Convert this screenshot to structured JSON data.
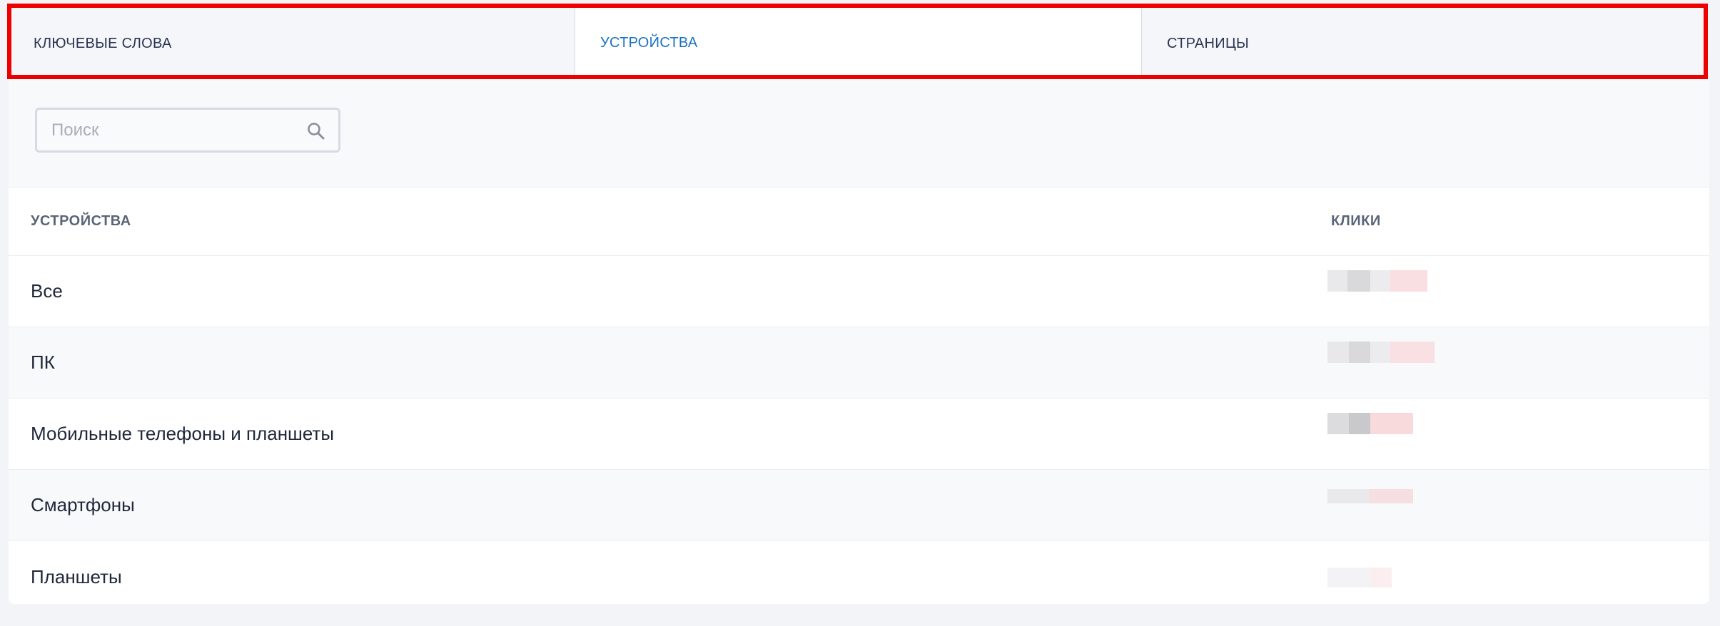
{
  "tabs": [
    {
      "label": "КЛЮЧЕВЫЕ СЛОВА",
      "active": false
    },
    {
      "label": "УСТРОЙСТВА",
      "active": true
    },
    {
      "label": "СТРАНИЦЫ",
      "active": false
    }
  ],
  "search": {
    "placeholder": "Поиск",
    "value": "",
    "icon": "search-icon"
  },
  "table": {
    "columns": [
      "УСТРОЙСТВА",
      "КЛИКИ"
    ],
    "rows": [
      {
        "device": "Все",
        "clicks": "redacted"
      },
      {
        "device": "ПК",
        "clicks": "redacted"
      },
      {
        "device": "Мобильные телефоны и планшеты",
        "clicks": "redacted"
      },
      {
        "device": "Смартфоны",
        "clicks": "redacted"
      },
      {
        "device": "Планшеты",
        "clicks": "redacted"
      }
    ]
  },
  "colors": {
    "active_tab_text": "#1b72c5",
    "tab_text": "#2a3551",
    "highlight_border": "#ee0000"
  }
}
